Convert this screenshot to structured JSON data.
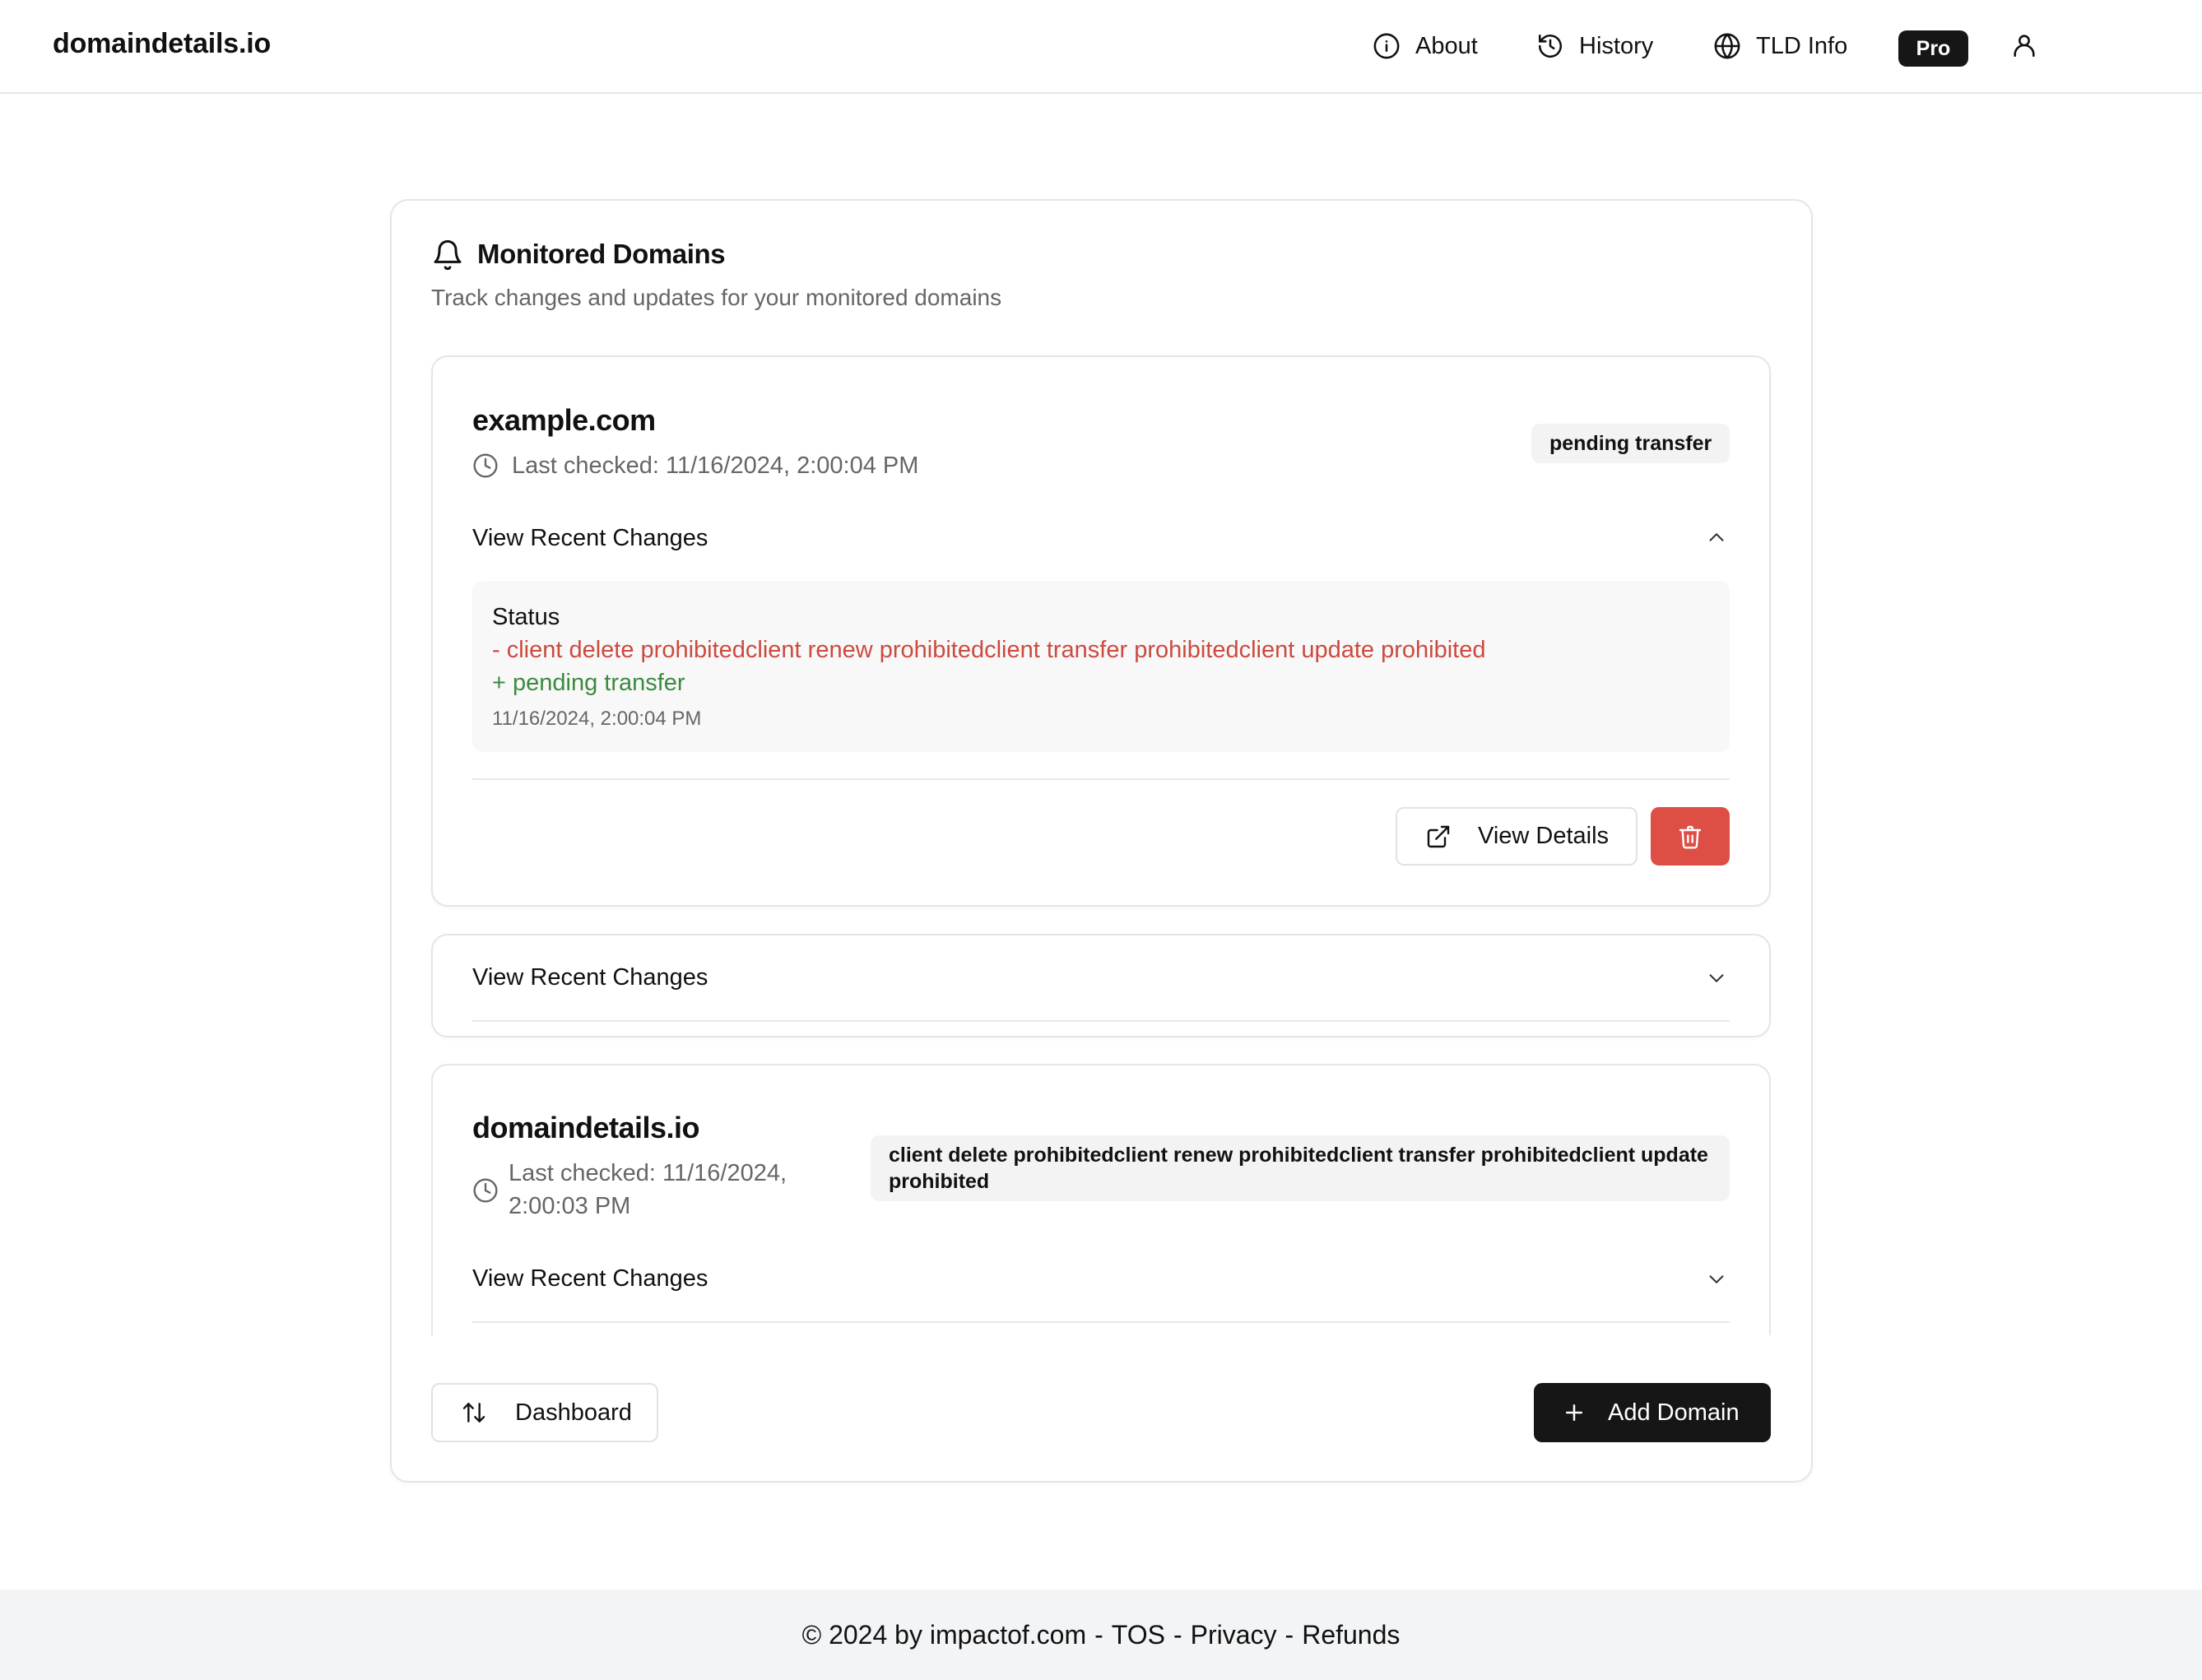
{
  "brand": "domaindetails.io",
  "nav": {
    "about": "About",
    "history": "History",
    "tld_info": "TLD Info",
    "pro": "Pro"
  },
  "monitored": {
    "title": "Monitored Domains",
    "subtitle": "Track changes and updates for your monitored domains",
    "domains": [
      {
        "name": "example.com",
        "last_checked": "Last checked: 11/16/2024, 2:00:04 PM",
        "status": "pending transfer",
        "accordion_label": "View Recent Changes",
        "expanded": true,
        "changes": {
          "field": "Status",
          "removed": "- client delete prohibitedclient renew prohibitedclient transfer prohibitedclient update prohibited",
          "added": "+ pending transfer",
          "time": "11/16/2024, 2:00:04 PM"
        },
        "view_details_label": "View Details"
      },
      {
        "accordion_label": "View Recent Changes",
        "expanded": false
      },
      {
        "name": "domaindetails.io",
        "last_checked_line1": "Last checked: 11/16/2024,",
        "last_checked_line2": "2:00:03 PM",
        "status_line1": "client delete prohibitedclient renew prohibitedclient transfer prohibitedclient update",
        "status_line2": "prohibited",
        "accordion_label": "View Recent Changes",
        "expanded": false
      }
    ],
    "dashboard_label": "Dashboard",
    "add_domain_label": "Add Domain"
  },
  "footer": {
    "copyright": "© 2024 by impactof.com",
    "tos": "TOS",
    "privacy": "Privacy",
    "refunds": "Refunds",
    "separator": "-"
  },
  "colors": {
    "removed": "#cc4a3f",
    "added": "#3d8a3e",
    "danger": "#dd4f45",
    "dark": "#161616"
  }
}
